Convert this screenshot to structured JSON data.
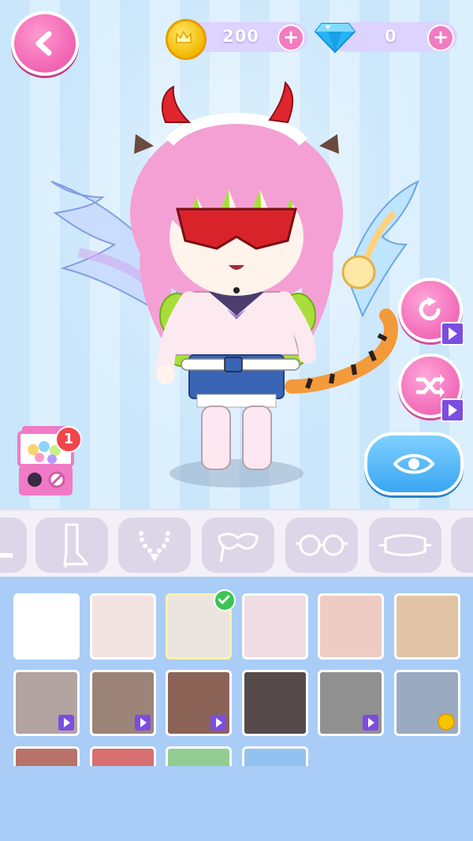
{
  "currency": {
    "coins": "200",
    "gems": "0"
  },
  "gacha": {
    "badge_count": "1"
  },
  "categories": [
    {
      "icon": "shoe-icon"
    },
    {
      "icon": "boot-icon"
    },
    {
      "icon": "necklace-icon"
    },
    {
      "icon": "masquerade-mask-icon"
    },
    {
      "icon": "round-glasses-icon"
    },
    {
      "icon": "sleep-mask-icon"
    },
    {
      "icon": "partial-item-icon"
    }
  ],
  "swatches": [
    {
      "color": "#ffffff",
      "lock": "none",
      "selected": false
    },
    {
      "color": "#f3e3e3",
      "lock": "none",
      "selected": false
    },
    {
      "color": "#ece4df",
      "lock": "none",
      "selected": true
    },
    {
      "color": "#efdde3",
      "lock": "none",
      "selected": false
    },
    {
      "color": "#efccc3",
      "lock": "none",
      "selected": false
    },
    {
      "color": "#e2c3a6",
      "lock": "none",
      "selected": false
    },
    {
      "color": "#b3a4a1",
      "lock": "ad",
      "selected": false
    },
    {
      "color": "#9c8478",
      "lock": "ad",
      "selected": false
    },
    {
      "color": "#8b6357",
      "lock": "ad",
      "selected": false
    },
    {
      "color": "#574a4a",
      "lock": "none",
      "selected": false
    },
    {
      "color": "#919090",
      "lock": "ad",
      "selected": false
    },
    {
      "color": "#9aaac1",
      "lock": "coin",
      "selected": false
    },
    {
      "color": "#b8726a",
      "lock": "none",
      "selected": false
    },
    {
      "color": "#d86f70",
      "lock": "none",
      "selected": false
    },
    {
      "color": "#92cc90",
      "lock": "none",
      "selected": false
    },
    {
      "color": "#94c2f0",
      "lock": "none",
      "selected": false
    }
  ]
}
